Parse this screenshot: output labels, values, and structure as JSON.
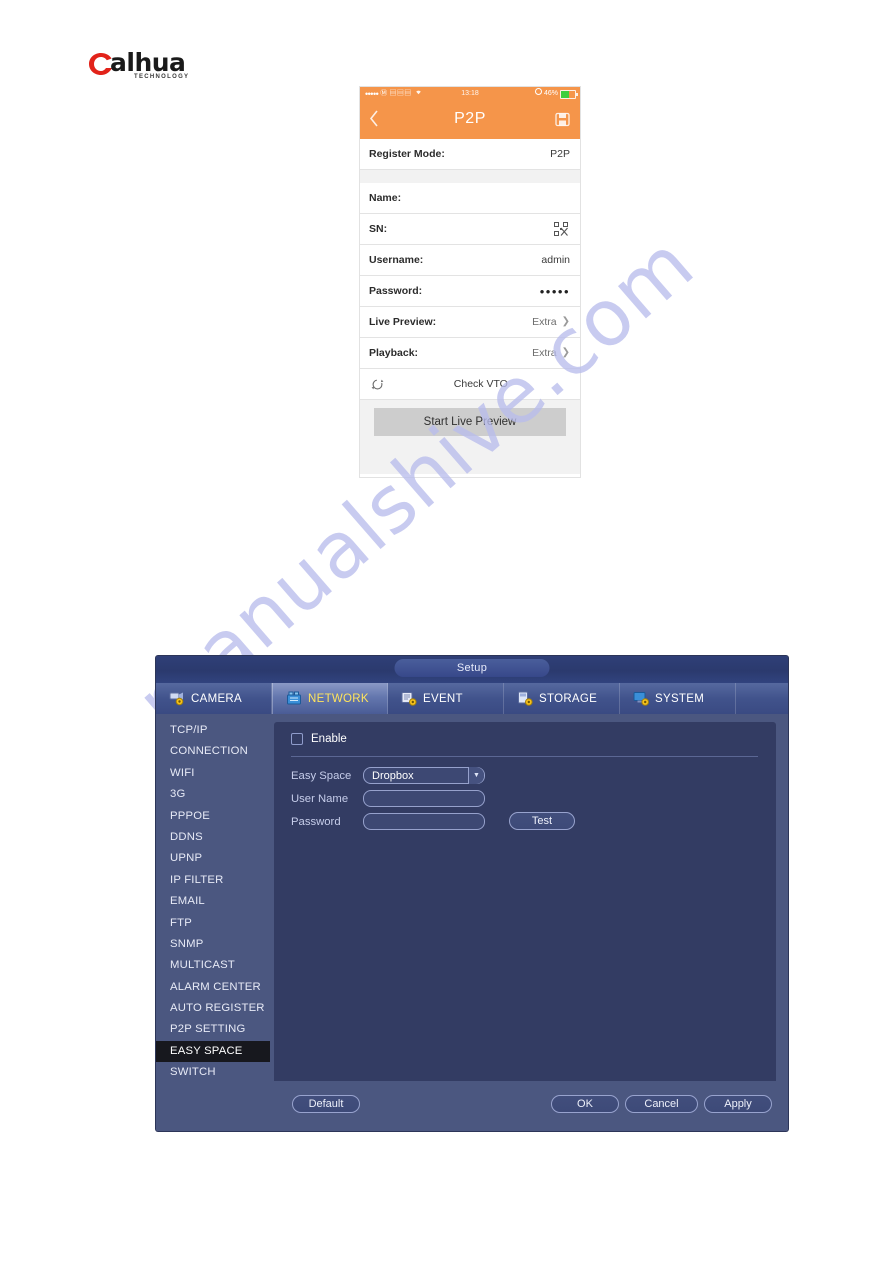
{
  "brand": {
    "name": "alhua",
    "tagline": "TECHNOLOGY"
  },
  "watermark": {
    "text": "manualshive.com"
  },
  "phone": {
    "status_bar": {
      "signal_dots": "•••••",
      "carrier_icons": "Ⓜ ▤▤▤",
      "wifi_icon": "wifi-icon",
      "time": "13:18",
      "alarm_icon": "alarm-icon",
      "battery_percent": "46%"
    },
    "nav": {
      "back_icon": "chevron-left-icon",
      "title": "P2P",
      "save_icon": "floppy-disk-icon"
    },
    "rows": [
      {
        "label": "Register Mode:",
        "value": "P2P",
        "type": "value"
      },
      {
        "label": "Name:",
        "value": "",
        "type": "value"
      },
      {
        "label": "SN:",
        "value": "",
        "type": "qr",
        "icon": "qr-scan-icon"
      },
      {
        "label": "Username:",
        "value": "admin",
        "type": "value"
      },
      {
        "label": "Password:",
        "value": "•••••",
        "type": "password"
      },
      {
        "label": "Live Preview:",
        "value": "Extra",
        "type": "chevron"
      },
      {
        "label": "Playback:",
        "value": "Extra",
        "type": "chevron"
      },
      {
        "label": "",
        "value": "Check VTO",
        "type": "refresh",
        "icon": "refresh-vto-icon"
      }
    ],
    "start_button": "Start Live Preview"
  },
  "dvr": {
    "window_title": "Setup",
    "tabs": [
      {
        "label": "CAMERA",
        "icon": "camera-gear-icon",
        "selected": false
      },
      {
        "label": "NETWORK",
        "icon": "network-gear-icon",
        "selected": true
      },
      {
        "label": "EVENT",
        "icon": "event-gear-icon",
        "selected": false
      },
      {
        "label": "STORAGE",
        "icon": "storage-gear-icon",
        "selected": false
      },
      {
        "label": "SYSTEM",
        "icon": "system-gear-icon",
        "selected": false
      }
    ],
    "sidebar": [
      {
        "label": "TCP/IP",
        "active": false
      },
      {
        "label": "CONNECTION",
        "active": false
      },
      {
        "label": "WIFI",
        "active": false
      },
      {
        "label": "3G",
        "active": false
      },
      {
        "label": "PPPOE",
        "active": false
      },
      {
        "label": "DDNS",
        "active": false
      },
      {
        "label": "UPNP",
        "active": false
      },
      {
        "label": "IP FILTER",
        "active": false
      },
      {
        "label": "EMAIL",
        "active": false
      },
      {
        "label": "FTP",
        "active": false
      },
      {
        "label": "SNMP",
        "active": false
      },
      {
        "label": "MULTICAST",
        "active": false
      },
      {
        "label": "ALARM CENTER",
        "active": false
      },
      {
        "label": "AUTO REGISTER",
        "active": false
      },
      {
        "label": "P2P SETTING",
        "active": false
      },
      {
        "label": "EASY SPACE",
        "active": true
      },
      {
        "label": "SWITCH",
        "active": false
      }
    ],
    "form": {
      "enable_label": "Enable",
      "enable_checked": false,
      "easy_space_label": "Easy Space",
      "easy_space_value": "Dropbox",
      "easy_space_options": [
        "Dropbox"
      ],
      "user_name_label": "User Name",
      "user_name_value": "",
      "user_name_placeholder": "",
      "password_label": "Password",
      "password_value": "",
      "password_placeholder": "",
      "test_button": "Test"
    },
    "footer": {
      "default_button": "Default",
      "ok_button": "OK",
      "cancel_button": "Cancel",
      "apply_button": "Apply"
    },
    "colors": {
      "panel_bg": "#333c63",
      "sidebar_bg": "#4b5780",
      "active_item_bg": "#17181e",
      "tab_selected_text": "#ffe45c",
      "phone_accent": "#f5954a"
    }
  }
}
